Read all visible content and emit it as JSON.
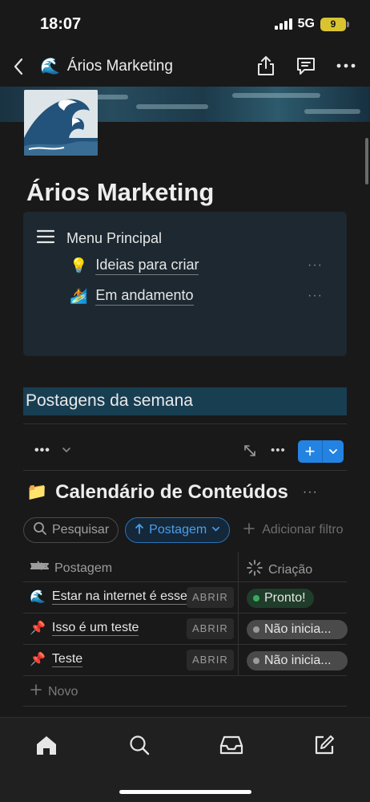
{
  "status_bar": {
    "time": "18:07",
    "network": "5G",
    "battery": "9"
  },
  "nav": {
    "title": "Ários Marketing",
    "page_emoji": "🌊"
  },
  "page": {
    "title": "Ários Marketing"
  },
  "menu": {
    "heading": "Menu Principal",
    "items": [
      {
        "emoji": "💡",
        "label": "Ideias para criar"
      },
      {
        "emoji": "🏄",
        "label": "Em andamento"
      }
    ],
    "more": "···"
  },
  "section": {
    "heading": "Postagens da semana"
  },
  "view_bar": {
    "more": "•••"
  },
  "database": {
    "emoji": "📁",
    "title": "Calendário de Conteúdos",
    "more": "···",
    "search_label": "Pesquisar",
    "sort_label": "Postagem",
    "add_filter_label": "Adicionar filtro",
    "columns": [
      "Postagem",
      "Criação"
    ],
    "rows": [
      {
        "emoji": "🌊",
        "name": "Estar na internet é essencial",
        "open": "ABRIR",
        "status": "Pronto!",
        "status_type": "ok"
      },
      {
        "emoji": "📌",
        "name": "Isso é um teste",
        "open": "ABRIR",
        "status": "Não inicia...",
        "status_type": "ns"
      },
      {
        "emoji": "📌",
        "name": "Teste",
        "open": "ABRIR",
        "status": "Não inicia...",
        "status_type": "ns"
      }
    ],
    "new_label": "Novo"
  },
  "colors": {
    "accent": "#2383e2",
    "section_bg": "#183e52",
    "menu_bg": "#1d2830",
    "ready_dot": "#3aaa5f"
  }
}
